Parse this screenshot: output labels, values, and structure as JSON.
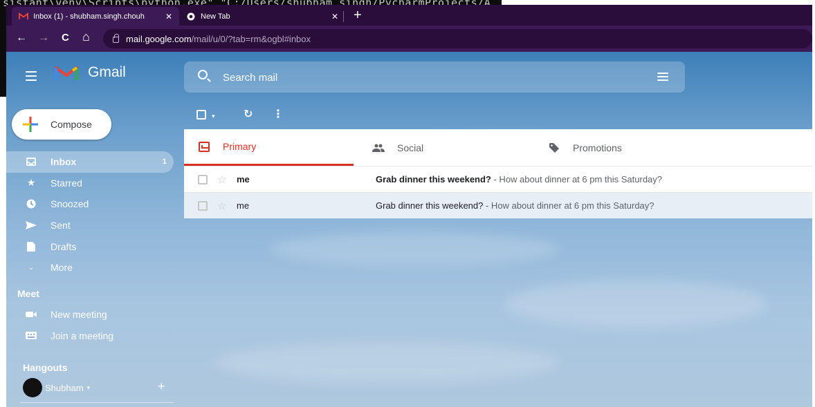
{
  "terminal": {
    "text": "sistant\\venv\\Scripts\\python.exe\" \"C:/Users/shubham singh/PycharmProjects/A"
  },
  "browser": {
    "tabs": [
      {
        "title": "Inbox (1) - shubham.singh.chouh",
        "icon": "gmail-icon",
        "close": "✕"
      },
      {
        "title": "New Tab",
        "icon": "chrome-icon",
        "close": "✕"
      }
    ],
    "new_tab": "+",
    "nav": {
      "back": "←",
      "forward": "→",
      "reload": "C",
      "home": "⌂"
    },
    "url": {
      "host": "mail.google.com",
      "path": "/mail/u/0/?tab=rm&ogbl#inbox"
    }
  },
  "gmail": {
    "logo_text": "Gmail",
    "search_placeholder": "Search mail",
    "compose_label": "Compose",
    "nav_items": [
      {
        "label": "Inbox",
        "icon": "inbox-icon",
        "count": "1"
      },
      {
        "label": "Starred",
        "icon": "star-icon"
      },
      {
        "label": "Snoozed",
        "icon": "clock-icon"
      },
      {
        "label": "Sent",
        "icon": "send-icon"
      },
      {
        "label": "Drafts",
        "icon": "draft-icon"
      },
      {
        "label": "More",
        "icon": "chevron-down-icon"
      }
    ],
    "meet": {
      "title": "Meet",
      "items": [
        {
          "label": "New meeting",
          "icon": "video-icon"
        },
        {
          "label": "Join a meeting",
          "icon": "keyboard-icon"
        }
      ]
    },
    "hangouts": {
      "title": "Hangouts",
      "user": "Shubham",
      "caret": "▾",
      "add": "+"
    },
    "categories": [
      {
        "label": "Primary",
        "icon": "inbox-icon"
      },
      {
        "label": "Social",
        "icon": "people-icon"
      },
      {
        "label": "Promotions",
        "icon": "tag-icon"
      }
    ],
    "emails": [
      {
        "sender": "me",
        "subject": "Grab dinner this weekend?",
        "snippet": " - How about dinner at 6 pm this Saturday?",
        "unread": true
      },
      {
        "sender": "me",
        "subject": "Grab dinner this weekend?",
        "snippet": " - How about dinner at 6 pm this Saturday?",
        "unread": false
      }
    ]
  }
}
